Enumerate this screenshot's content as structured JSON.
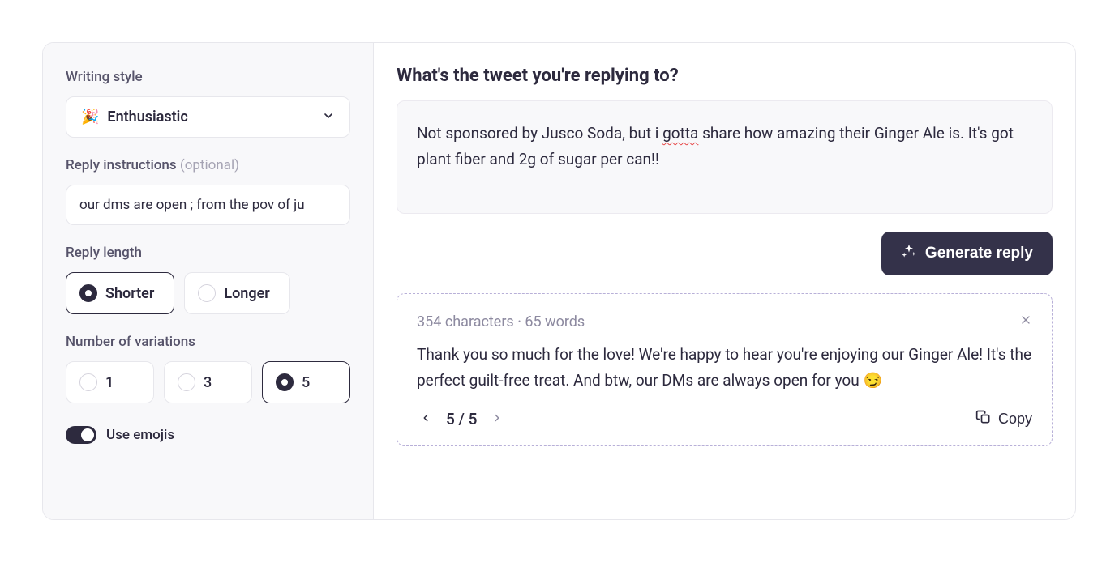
{
  "sidebar": {
    "writing_style": {
      "label": "Writing style",
      "emoji": "🎉",
      "selected": "Enthusiastic"
    },
    "reply_instructions": {
      "label": "Reply instructions ",
      "optional": "(optional)",
      "value": "our dms are open ; from the pov of ju"
    },
    "reply_length": {
      "label": "Reply length",
      "options": [
        "Shorter",
        "Longer"
      ],
      "selected": "Shorter"
    },
    "variations": {
      "label": "Number of variations",
      "options": [
        "1",
        "3",
        "5"
      ],
      "selected": "5"
    },
    "emojis": {
      "label": "Use emojis",
      "on": true
    }
  },
  "main": {
    "heading": "What's the tweet you're replying to?",
    "tweet_pre": "Not sponsored by Jusco Soda, but i ",
    "tweet_gotta": "gotta",
    "tweet_post": " share how amazing their Ginger Ale is. It's got plant fiber and 2g of sugar per can!!",
    "generate_label": "Generate reply"
  },
  "result": {
    "meta": "354 characters · 65 words",
    "body": "Thank you so much for the love! We're happy to hear you're enjoying our Ginger Ale! It's the perfect guilt-free treat. And btw, our DMs are always open for you 😏",
    "pager": "5 / 5",
    "copy_label": "Copy"
  }
}
